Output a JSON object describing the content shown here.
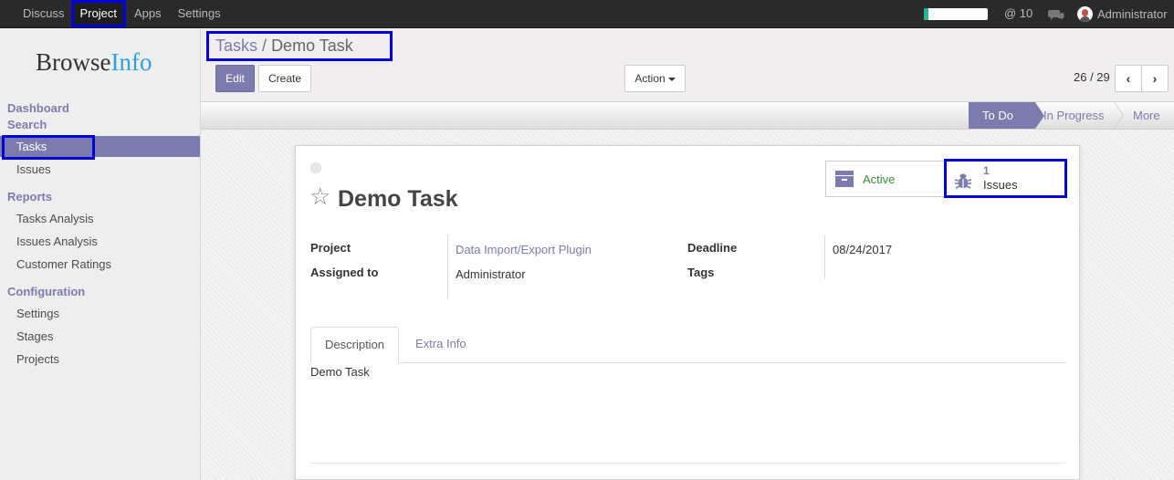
{
  "topbar": {
    "menu": [
      "Discuss",
      "Project",
      "Apps",
      "Settings"
    ],
    "active_menu": "Project",
    "mentions": "@ 10",
    "user": "Administrator",
    "progress_fraction": 0.07
  },
  "sidebar": {
    "logo_part1": "Browse",
    "logo_part2": "Info",
    "sections": {
      "dashboard": "Dashboard",
      "search": "Search",
      "reports": "Reports",
      "configuration": "Configuration"
    },
    "search_items": [
      "Tasks",
      "Issues"
    ],
    "report_items": [
      "Tasks Analysis",
      "Issues Analysis",
      "Customer Ratings"
    ],
    "config_items": [
      "Settings",
      "Stages",
      "Projects"
    ]
  },
  "control_panel": {
    "breadcrumb_parent": "Tasks",
    "breadcrumb_sep": "/",
    "breadcrumb_current": "Demo Task",
    "edit_label": "Edit",
    "create_label": "Create",
    "action_label": "Action",
    "pager": "26 / 29",
    "prev_symbol": "‹",
    "next_symbol": "›"
  },
  "stages": {
    "current": "To Do",
    "next": "In Progress",
    "more": "More"
  },
  "form": {
    "title": "Demo Task",
    "smart_active": "Active",
    "smart_issues_count": "1",
    "smart_issues_label": "Issues",
    "project_label": "Project",
    "project_value": "Data Import/Export Plugin",
    "assigned_label": "Assigned to",
    "assigned_value": "Administrator",
    "deadline_label": "Deadline",
    "deadline_value": "08/24/2017",
    "tags_label": "Tags",
    "tab_description": "Description",
    "tab_extra": "Extra Info",
    "description": "Demo Task"
  },
  "colors": {
    "accent": "#7c7bad",
    "highlight": "#0000dd",
    "active_green": "#3b8b3b"
  }
}
